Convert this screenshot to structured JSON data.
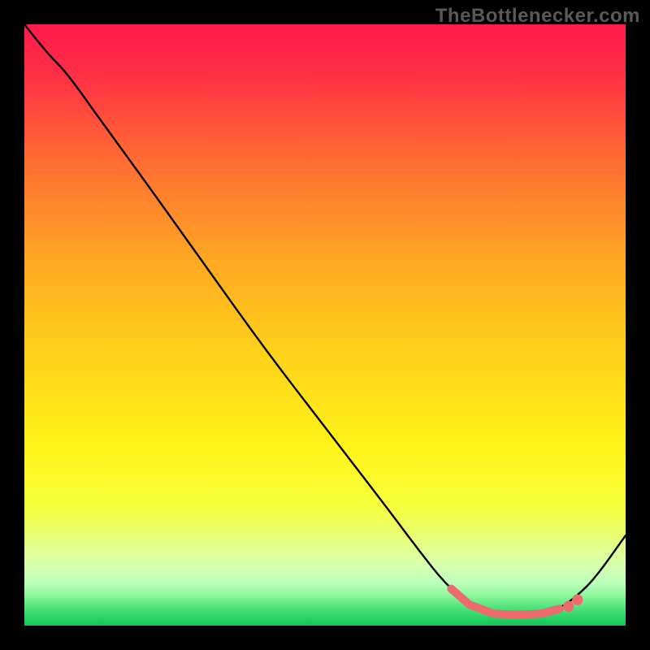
{
  "attribution": "TheBottlenecker.com",
  "colors": {
    "frame": "#000000",
    "curve": "#000000",
    "marker": "#ed6a6f"
  },
  "chart_data": {
    "type": "line",
    "title": "",
    "xlabel": "",
    "ylabel": "",
    "xlim": [
      0,
      100
    ],
    "ylim": [
      0,
      100
    ],
    "gradient_stops": [
      {
        "pct": 0,
        "color": "#ff1a4b"
      },
      {
        "pct": 8,
        "color": "#ff2e45"
      },
      {
        "pct": 22,
        "color": "#ff6a33"
      },
      {
        "pct": 40,
        "color": "#ffaa22"
      },
      {
        "pct": 55,
        "color": "#ffd21a"
      },
      {
        "pct": 70,
        "color": "#fff31a"
      },
      {
        "pct": 80,
        "color": "#f7ff3a"
      },
      {
        "pct": 86,
        "color": "#e5ff80"
      },
      {
        "pct": 90,
        "color": "#d7ffb0"
      },
      {
        "pct": 93,
        "color": "#baffba"
      },
      {
        "pct": 95,
        "color": "#8cf79a"
      },
      {
        "pct": 97,
        "color": "#4de37a"
      },
      {
        "pct": 100,
        "color": "#10c756"
      }
    ],
    "series": [
      {
        "name": "bottleneck-curve",
        "points": [
          {
            "x": 0,
            "y": 100
          },
          {
            "x": 4,
            "y": 95
          },
          {
            "x": 7,
            "y": 92
          },
          {
            "x": 12,
            "y": 85
          },
          {
            "x": 20,
            "y": 74
          },
          {
            "x": 30,
            "y": 60
          },
          {
            "x": 40,
            "y": 46
          },
          {
            "x": 50,
            "y": 33
          },
          {
            "x": 60,
            "y": 20
          },
          {
            "x": 66,
            "y": 12
          },
          {
            "x": 70,
            "y": 7
          },
          {
            "x": 74,
            "y": 3.5
          },
          {
            "x": 78,
            "y": 2
          },
          {
            "x": 82,
            "y": 1.8
          },
          {
            "x": 86,
            "y": 2
          },
          {
            "x": 89,
            "y": 2.8
          },
          {
            "x": 92,
            "y": 5
          },
          {
            "x": 95,
            "y": 8
          },
          {
            "x": 100,
            "y": 15
          }
        ]
      }
    ],
    "highlight_segment": {
      "x_start": 71,
      "x_end": 89
    },
    "highlight_dots": [
      {
        "x": 90.5,
        "y": 3.2
      },
      {
        "x": 92,
        "y": 4.3
      }
    ]
  }
}
